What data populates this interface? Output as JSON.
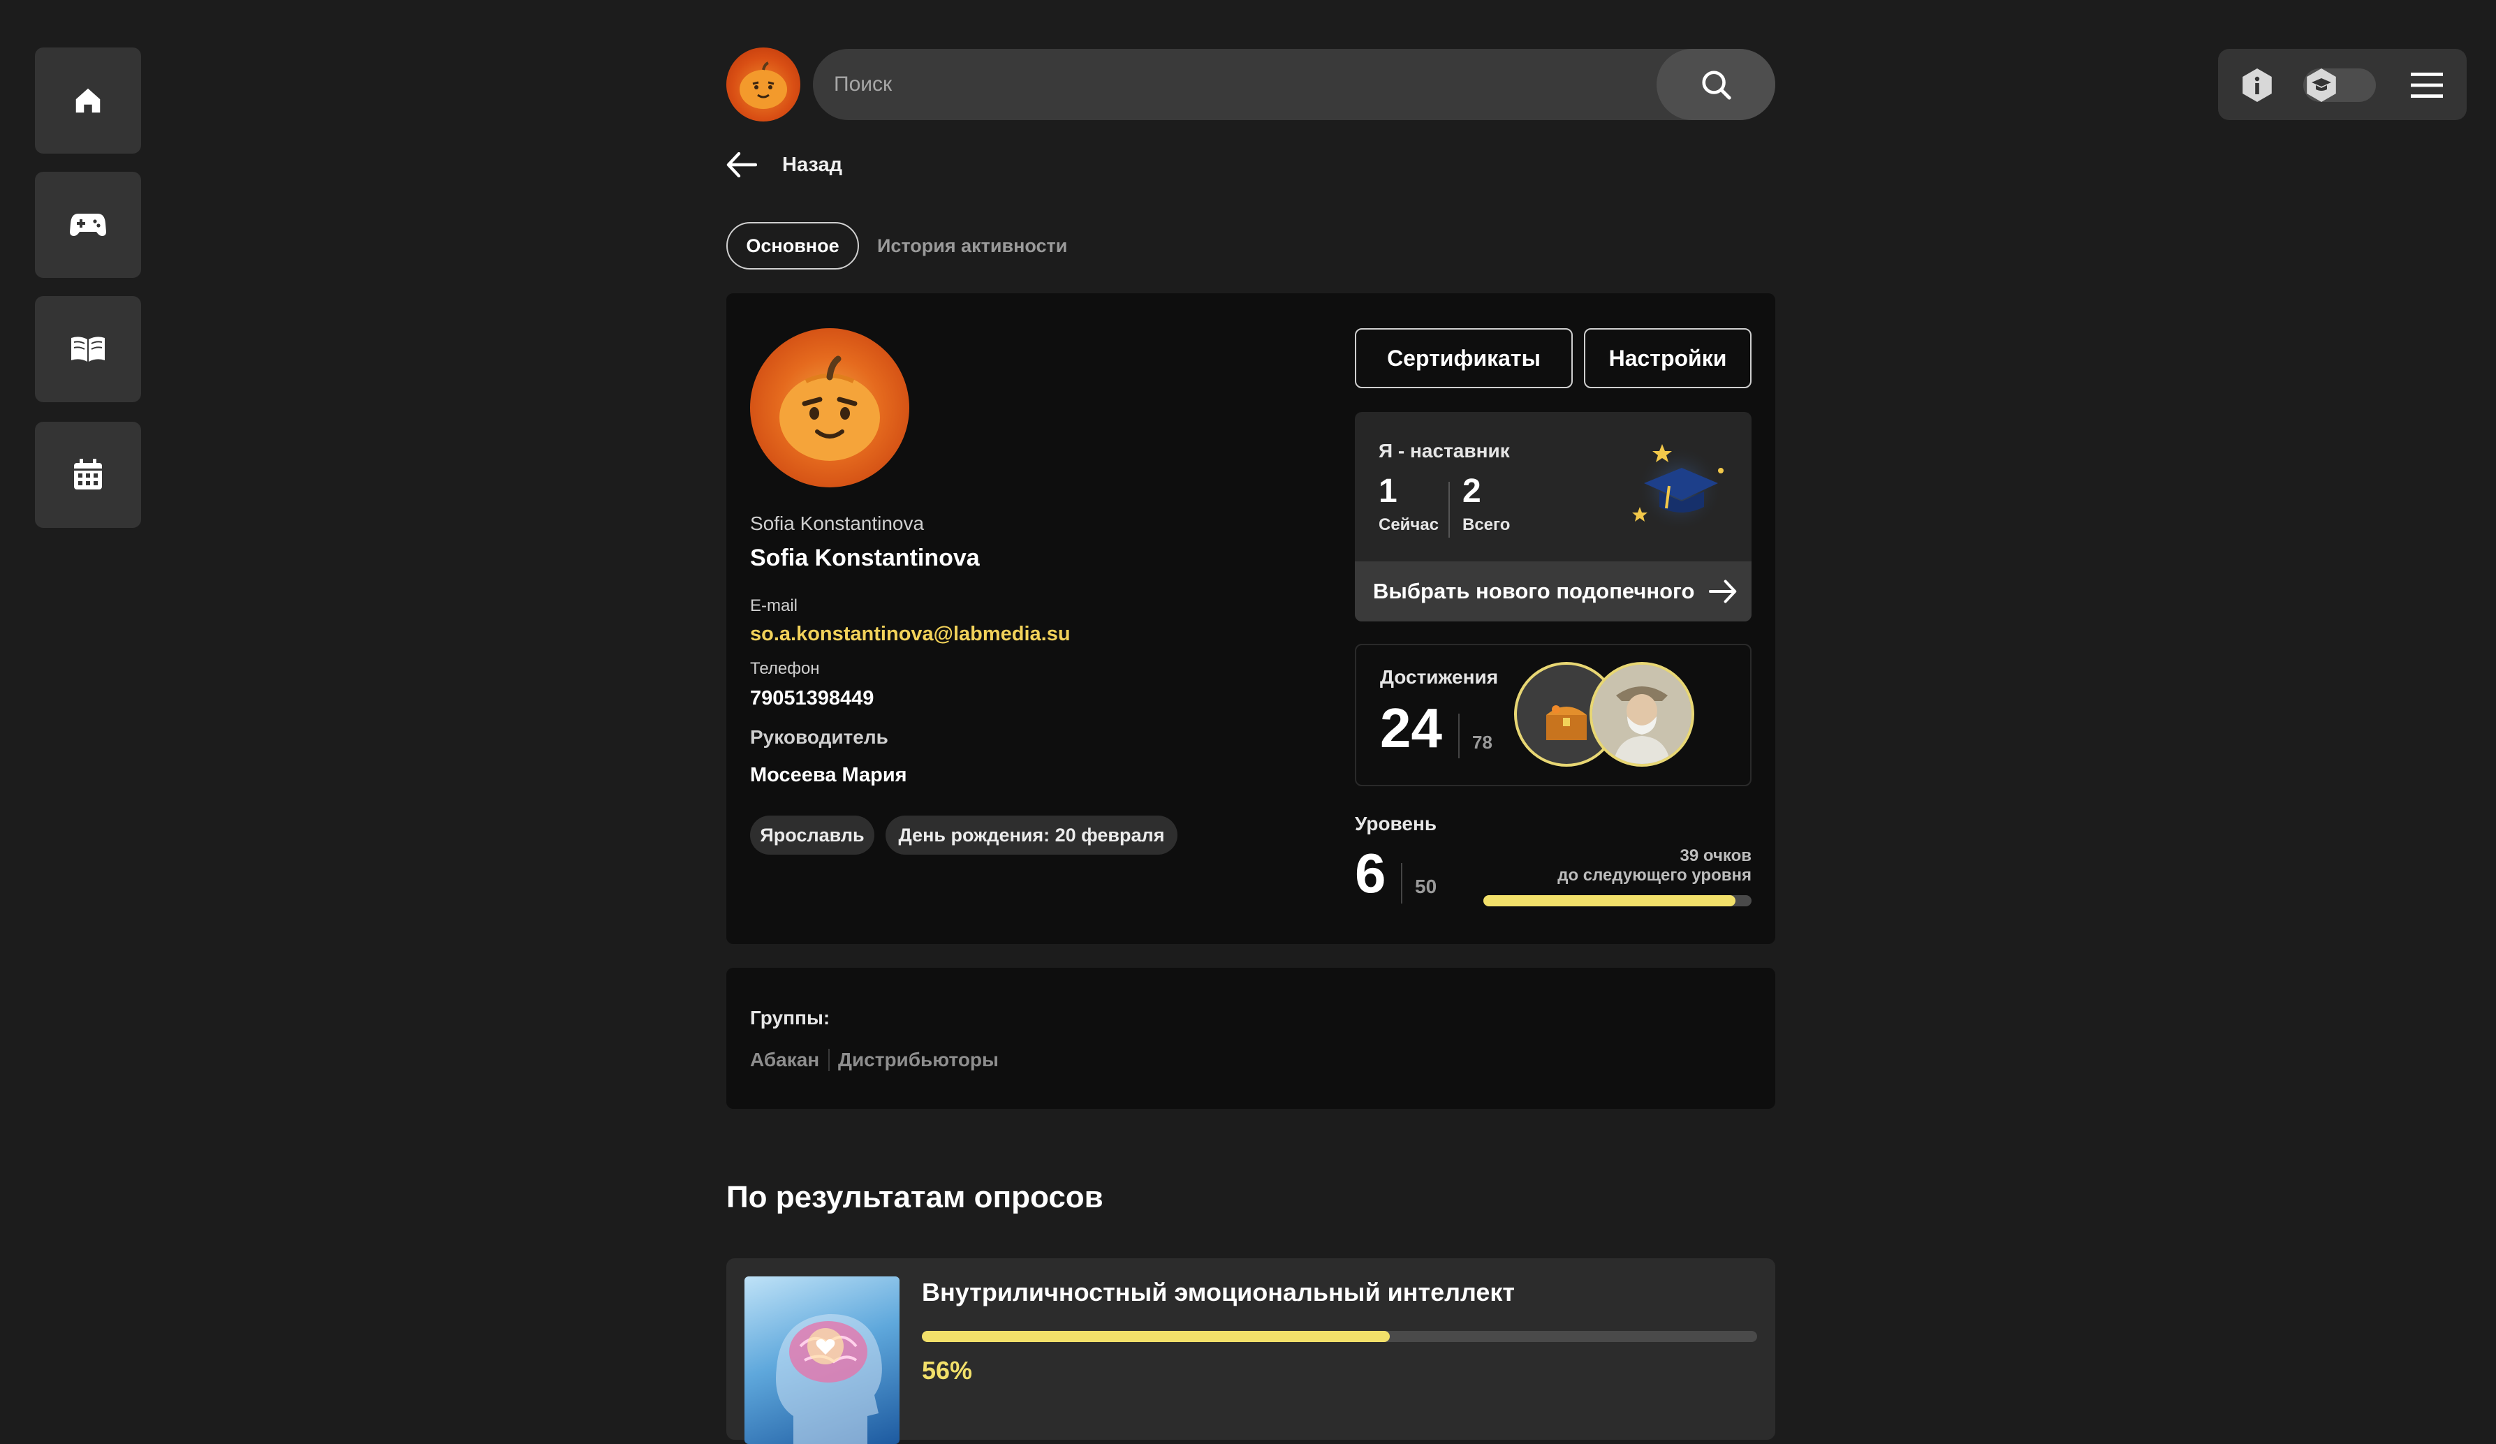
{
  "sidebar": {
    "items": [
      {
        "icon": "home-icon"
      },
      {
        "icon": "gamepad-icon"
      },
      {
        "icon": "book-icon"
      },
      {
        "icon": "calendar-icon"
      }
    ]
  },
  "header": {
    "search_placeholder": "Поиск"
  },
  "nav": {
    "back_label": "Назад"
  },
  "tabs": [
    {
      "label": "Основное",
      "active": true
    },
    {
      "label": "История активности",
      "active": false
    }
  ],
  "profile": {
    "username": "Sofia Konstantinova",
    "full_name": "Sofia Konstantinova",
    "email_label": "E-mail",
    "email": "so.a.konstantinova@labmedia.su",
    "phone_label": "Телефон",
    "phone": "79051398449",
    "manager_label": "Руководитель",
    "manager": "Мосеева Мария",
    "city": "Ярославль",
    "birthday": "День рождения: 20 февраля"
  },
  "actions": {
    "certificates": "Сертификаты",
    "settings": "Настройки"
  },
  "mentor": {
    "title": "Я - наставник",
    "now_value": "1",
    "now_label": "Сейчас",
    "total_value": "2",
    "total_label": "Всего",
    "choose_label": "Выбрать нового подопечного"
  },
  "achievements": {
    "title": "Достижения",
    "count": "24",
    "total": "78"
  },
  "level": {
    "title": "Уровень",
    "value": "6",
    "max": "50",
    "points_text": "39 очков",
    "next_text": "до следующего уровня",
    "progress": 0.94
  },
  "groups": {
    "title": "Группы:",
    "items": [
      "Абакан",
      "Дистрибьюторы"
    ]
  },
  "surveys": {
    "title": "По результатам опросов",
    "items": [
      {
        "name": "Внутриличностный эмоциональный интеллект",
        "percent_text": "56%",
        "progress": 0.56
      }
    ]
  },
  "colors": {
    "accent_yellow": "#f2e06a",
    "email_yellow": "#f2d25a",
    "background": "#1c1c1c",
    "card": "#0e0e0e"
  }
}
